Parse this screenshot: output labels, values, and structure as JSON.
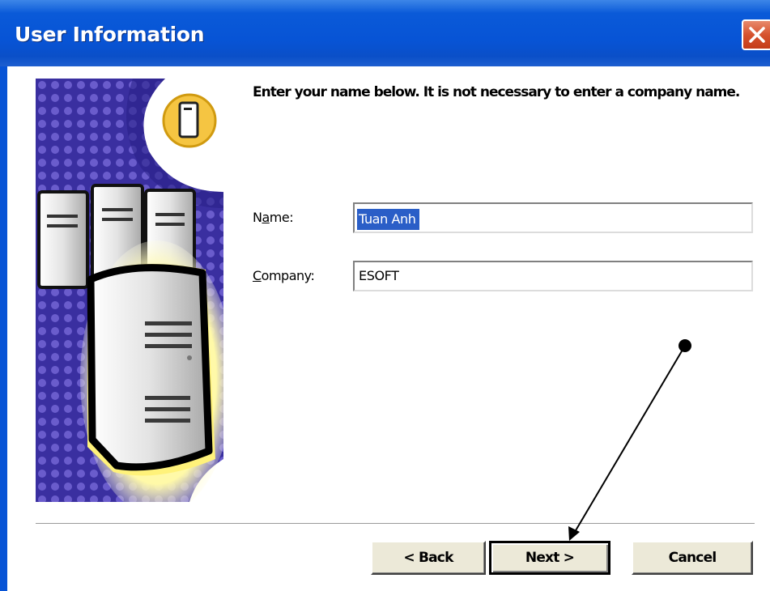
{
  "window": {
    "title": "User Information",
    "close_icon": "close-icon"
  },
  "instruction": "Enter your name below.  It is not necessary to enter a company name.",
  "fields": {
    "name": {
      "label_pre": "N",
      "label_ul": "a",
      "label_post": "me:",
      "value": "Tuan Anh"
    },
    "company": {
      "label_pre": "",
      "label_ul": "C",
      "label_post": "ompany:",
      "value": "ESOFT"
    }
  },
  "buttons": {
    "back": "< Back",
    "next": "Next >",
    "cancel": "Cancel"
  },
  "colors": {
    "titlebar": "#0754d6",
    "close": "#d6522e",
    "selection": "#2a5ec7",
    "button_face": "#ece9d8"
  },
  "side_graphic_icon": "server-icon"
}
